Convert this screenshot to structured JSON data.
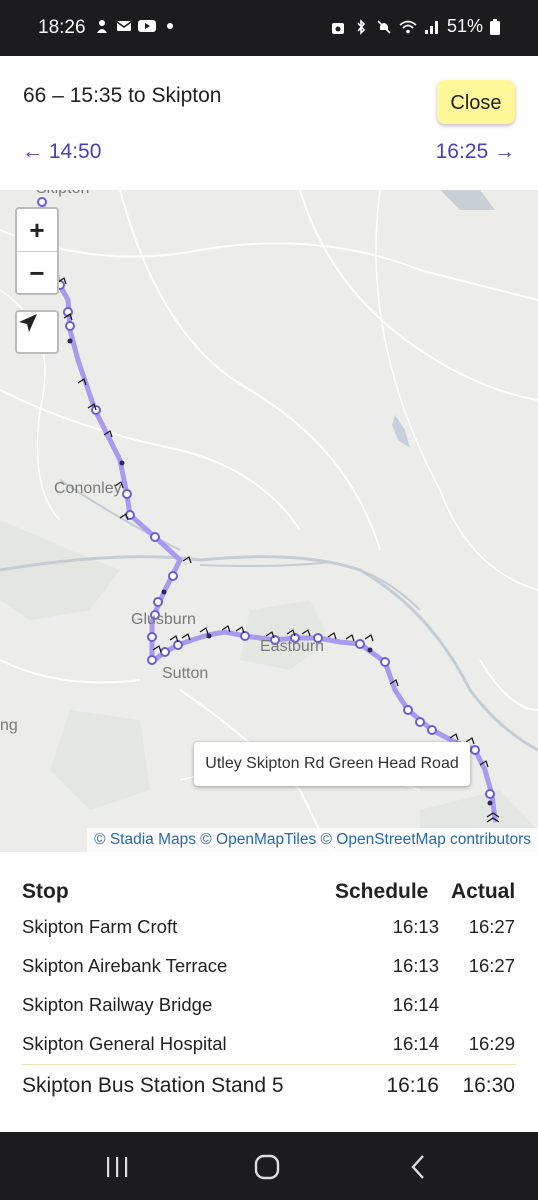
{
  "status_bar": {
    "time": "18:26",
    "battery": "51%",
    "icons_left": [
      "notification-icon",
      "mail-icon",
      "youtube-icon",
      "dot-icon"
    ],
    "icons_right": [
      "bag-icon",
      "bluetooth-icon",
      "mute-icon",
      "wifi-icon",
      "signal-icon",
      "battery-icon"
    ]
  },
  "header": {
    "title": "66 – 15:35 to Skipton",
    "close_label": "Close",
    "prev_label": "← 14:50",
    "next_label": "16:25 →",
    "close_color": "#fff79a",
    "link_color": "#4b40b8"
  },
  "map": {
    "zoom_in": "+",
    "zoom_out": "−",
    "labels": {
      "skipton": "Skipton",
      "cononley": "Cononley",
      "glusburn": "Glusburn",
      "sutton": "Sutton",
      "eastburn": "Eastburn",
      "edge": "ng"
    },
    "tooltip": "Utley Skipton Rd Green Head Road",
    "attribution": "© Stadia Maps © OpenMapTiles © OpenStreetMap contributors",
    "route_color": "#a99af0"
  },
  "table": {
    "headers": {
      "stop": "Stop",
      "schedule": "Schedule",
      "actual": "Actual"
    },
    "rows": [
      {
        "stop": "Skipton Farm Croft",
        "schedule": "16:13",
        "actual": "16:27"
      },
      {
        "stop": "Skipton Airebank Terrace",
        "schedule": "16:13",
        "actual": "16:27"
      },
      {
        "stop": "Skipton Railway Bridge",
        "schedule": "16:14",
        "actual": ""
      },
      {
        "stop": "Skipton General Hospital",
        "schedule": "16:14",
        "actual": "16:29"
      },
      {
        "stop": "Skipton Bus Station Stand 5",
        "schedule": "16:16",
        "actual": "16:30"
      }
    ]
  },
  "nav_bar": {
    "icons": [
      "recents-icon",
      "home-icon",
      "back-icon"
    ]
  }
}
